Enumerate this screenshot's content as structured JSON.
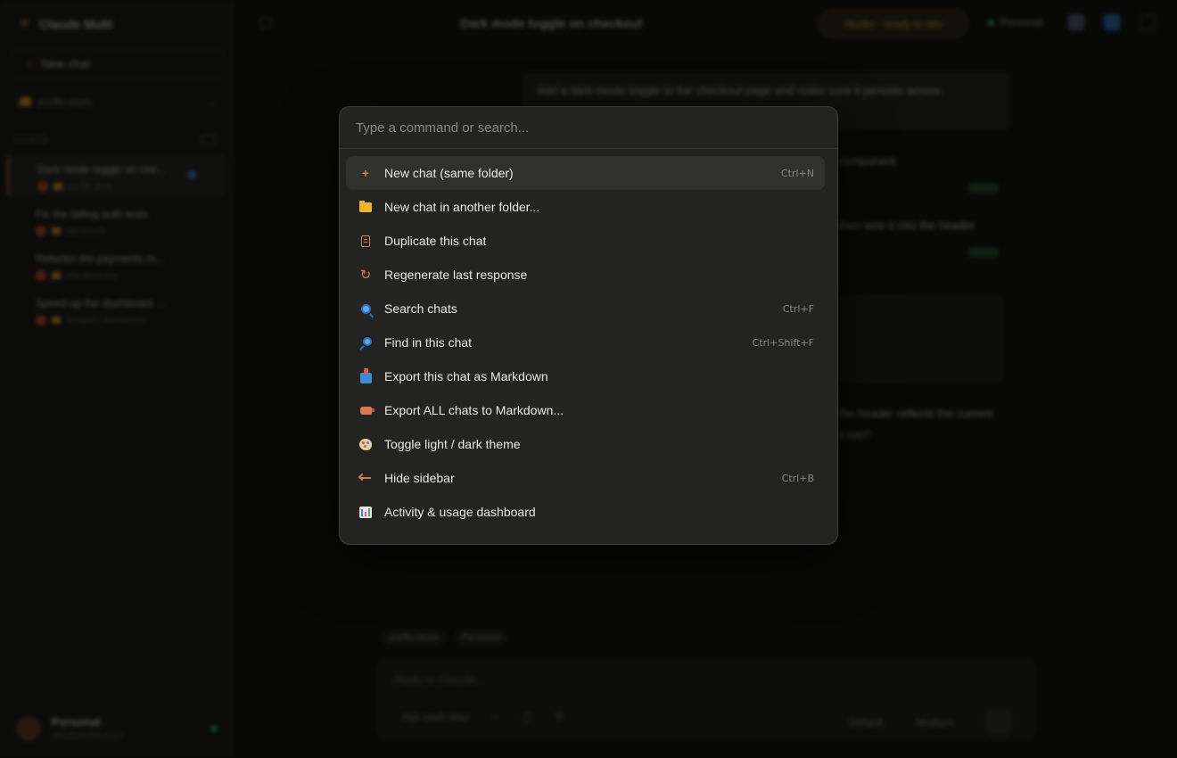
{
  "sidebar": {
    "app_title": "Claude Multi",
    "new_chat_label": "New chat",
    "folder_name": "purfle-store",
    "chats_label": "CHATS",
    "chats": [
      {
        "title": "Dark mode toggle on che...",
        "meta": "purfle-store",
        "active": true
      },
      {
        "title": "Fix the failing auth tests",
        "meta": "api-server",
        "active": false
      },
      {
        "title": "Refactor the payments m...",
        "meta": "checkout-svc",
        "active": false
      },
      {
        "title": "Speed up the dashboard ...",
        "meta": "analytics-dashboard",
        "active": false
      }
    ],
    "user": {
      "name": "Personal",
      "email": "you@acme.com"
    }
  },
  "topbar": {
    "title": "Dark mode toggle on checkout",
    "status_pill": "Studio · ready to dev",
    "account": "Personal"
  },
  "conversation": {
    "user_message": "Add a dark-mode toggle to the checkout page and make sure it persists across",
    "line1": "component.",
    "line2": "then wire it into the header",
    "line3": "the header reflects the current",
    "line4": "o too?"
  },
  "composer": {
    "tags": [
      "purfle-store",
      "Personal"
    ],
    "placeholder": "Reply to Claude...",
    "ask_label": "Ask each time",
    "model": "Default",
    "effort": "Medium"
  },
  "palette": {
    "search_placeholder": "Type a command or search...",
    "commands": [
      {
        "icon": "plus-icon",
        "label": "New chat (same folder)",
        "shortcut": "Ctrl+N",
        "selected": true
      },
      {
        "icon": "folder-icon",
        "label": "New chat in another folder...",
        "shortcut": ""
      },
      {
        "icon": "duplicate-icon",
        "label": "Duplicate this chat",
        "shortcut": ""
      },
      {
        "icon": "regenerate-icon",
        "label": "Regenerate last response",
        "shortcut": ""
      },
      {
        "icon": "search-icon",
        "label": "Search chats",
        "shortcut": "Ctrl+F"
      },
      {
        "icon": "find-icon",
        "label": "Find in this chat",
        "shortcut": "Ctrl+Shift+F"
      },
      {
        "icon": "export-icon",
        "label": "Export this chat as Markdown",
        "shortcut": ""
      },
      {
        "icon": "export-all-icon",
        "label": "Export ALL chats to Markdown...",
        "shortcut": ""
      },
      {
        "icon": "palette-icon",
        "label": "Toggle light / dark theme",
        "shortcut": ""
      },
      {
        "icon": "hide-sidebar-icon",
        "label": "Hide sidebar",
        "shortcut": "Ctrl+B"
      },
      {
        "icon": "dashboard-icon",
        "label": "Activity & usage dashboard",
        "shortcut": ""
      }
    ]
  },
  "colors": {
    "accent": "#d9774f",
    "background": "#0d0d0c",
    "palette_bg": "#232321"
  }
}
